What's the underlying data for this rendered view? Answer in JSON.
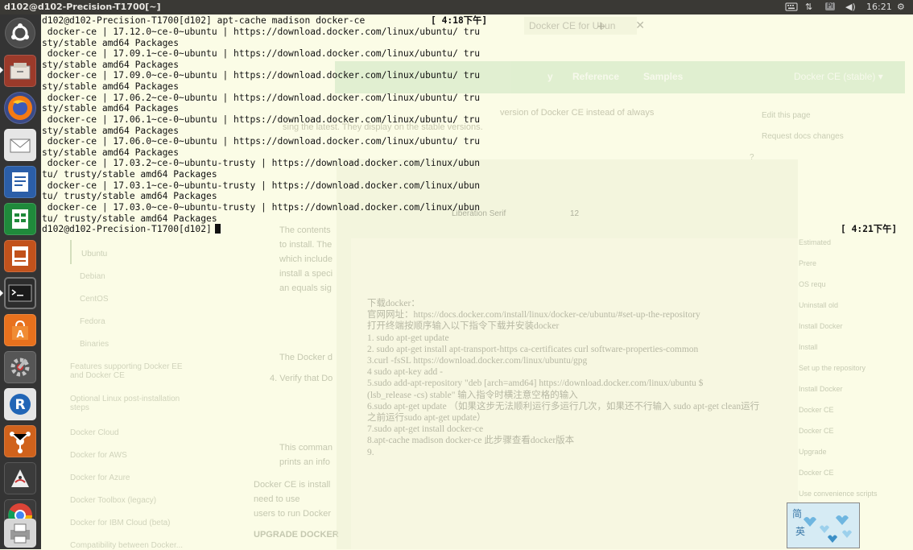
{
  "window_title": "d102@d102-Precision-T1700[~]",
  "tray": {
    "input_method": "Pi",
    "time": "16:21"
  },
  "launcher_icons": [
    "ubuntu-dash-icon",
    "files-icon",
    "firefox-icon",
    "mail-icon",
    "writer-icon",
    "calc-icon",
    "impress-icon",
    "terminal-icon",
    "software-center-icon",
    "settings-icon",
    "r-icon",
    "network-app-icon",
    "java-icon",
    "chrome-icon",
    "printer-icon"
  ],
  "terminal": {
    "command_line": "d102@d102-Precision-T1700[d102] apt-cache madison docker-ce",
    "command_time": "[ 4:18下午]",
    "output_lines": [
      " docker-ce | 17.12.0~ce-0~ubuntu | https://download.docker.com/linux/ubuntu/ tru",
      "sty/stable amd64 Packages",
      " docker-ce | 17.09.1~ce-0~ubuntu | https://download.docker.com/linux/ubuntu/ tru",
      "sty/stable amd64 Packages",
      " docker-ce | 17.09.0~ce-0~ubuntu | https://download.docker.com/linux/ubuntu/ tru",
      "sty/stable amd64 Packages",
      " docker-ce | 17.06.2~ce-0~ubuntu | https://download.docker.com/linux/ubuntu/ tru",
      "sty/stable amd64 Packages",
      " docker-ce | 17.06.1~ce-0~ubuntu | https://download.docker.com/linux/ubuntu/ tru",
      "sty/stable amd64 Packages",
      " docker-ce | 17.06.0~ce-0~ubuntu | https://download.docker.com/linux/ubuntu/ tru",
      "sty/stable amd64 Packages",
      " docker-ce | 17.03.2~ce-0~ubuntu-trusty | https://download.docker.com/linux/ubun",
      "tu/ trusty/stable amd64 Packages",
      " docker-ce | 17.03.1~ce-0~ubuntu-trusty | https://download.docker.com/linux/ubun",
      "tu/ trusty/stable amd64 Packages",
      " docker-ce | 17.03.0~ce-0~ubuntu-trusty | https://download.docker.com/linux/ubun",
      "tu/ trusty/stable amd64 Packages"
    ],
    "prompt": "d102@d102-Precision-T1700[d102]",
    "prompt_time": "[ 4:21下午]"
  },
  "ghost_browser": {
    "tab_title": "Docker CE for Ubun",
    "nav": [
      "y",
      "Reference",
      "Samples"
    ],
    "nav_right": "Docker CE (stable) ▾",
    "intro": [
      "version of Docker CE instead of always",
      "sing the latest. They display on the stable versions."
    ],
    "right_links": [
      "Edit this page",
      "Request docs changes",
      "?"
    ],
    "sidebar": [
      "Ubuntu",
      "Debian",
      "CentOS",
      "Fedora",
      "Binaries",
      "Features supporting Docker EE and Docker CE",
      "Optional Linux post-installation steps",
      "Docker Cloud",
      "Docker for AWS",
      "Docker for Azure",
      "Docker Toolbox (legacy)",
      "Docker for IBM Cloud (beta)",
      "Compatibility between Docker..."
    ],
    "body_snippets": [
      "The contents",
      "to install. The",
      "which include",
      "install a speci",
      "an equals sig",
      "The Docker d",
      "4. Verify that Do",
      "This comman",
      "prints an info",
      "Docker CE is install",
      "need to use",
      "users to run Docker",
      "UPGRADE DOCKER"
    ],
    "toc": [
      "Estimated",
      "Prere",
      "OS requ",
      "Uninstall old",
      "Install Docker",
      "Install",
      "Set up the repository",
      "Install Docker",
      "Docker CE",
      "Docker CE",
      "Upgrade",
      "Docker CE",
      "Use convenience scripts"
    ]
  },
  "ghost_doc": {
    "font_name": "Liberation Serif",
    "font_size": "12",
    "lines": [
      "下载docker：",
      "官网网址：https://docs.docker.com/install/linux/docker-ce/ubuntu/#set-up-the-repository",
      "打开终端按顺序输入以下指令下载并安装docker",
      "1. sudo apt-get update",
      "2. sudo apt-get install apt-transport-https ca-certificates curl software-properties-common",
      "3.curl -fsSL https://download.docker.com/linux/ubuntu/gpg",
      "4 sudo apt-key add -",
      "5.sudo add-apt-repository \"deb [arch=amd64] https://download.docker.com/linux/ubuntu $",
      "(lsb_release -cs) stable\"     输入指令时横注意空格的输入",
      "6.sudo apt-get update  （如果这步无法顺利运行多运行几次，如果还不行输入 sudo apt-get clean运行",
      "之前运行sudo apt-get update）",
      "7.sudo apt-get install docker-ce",
      "8.apt-cache madison docker-ce   此步骤查看docker版本",
      "9."
    ]
  },
  "thumbnail": {
    "chars": [
      "简",
      "英"
    ]
  }
}
